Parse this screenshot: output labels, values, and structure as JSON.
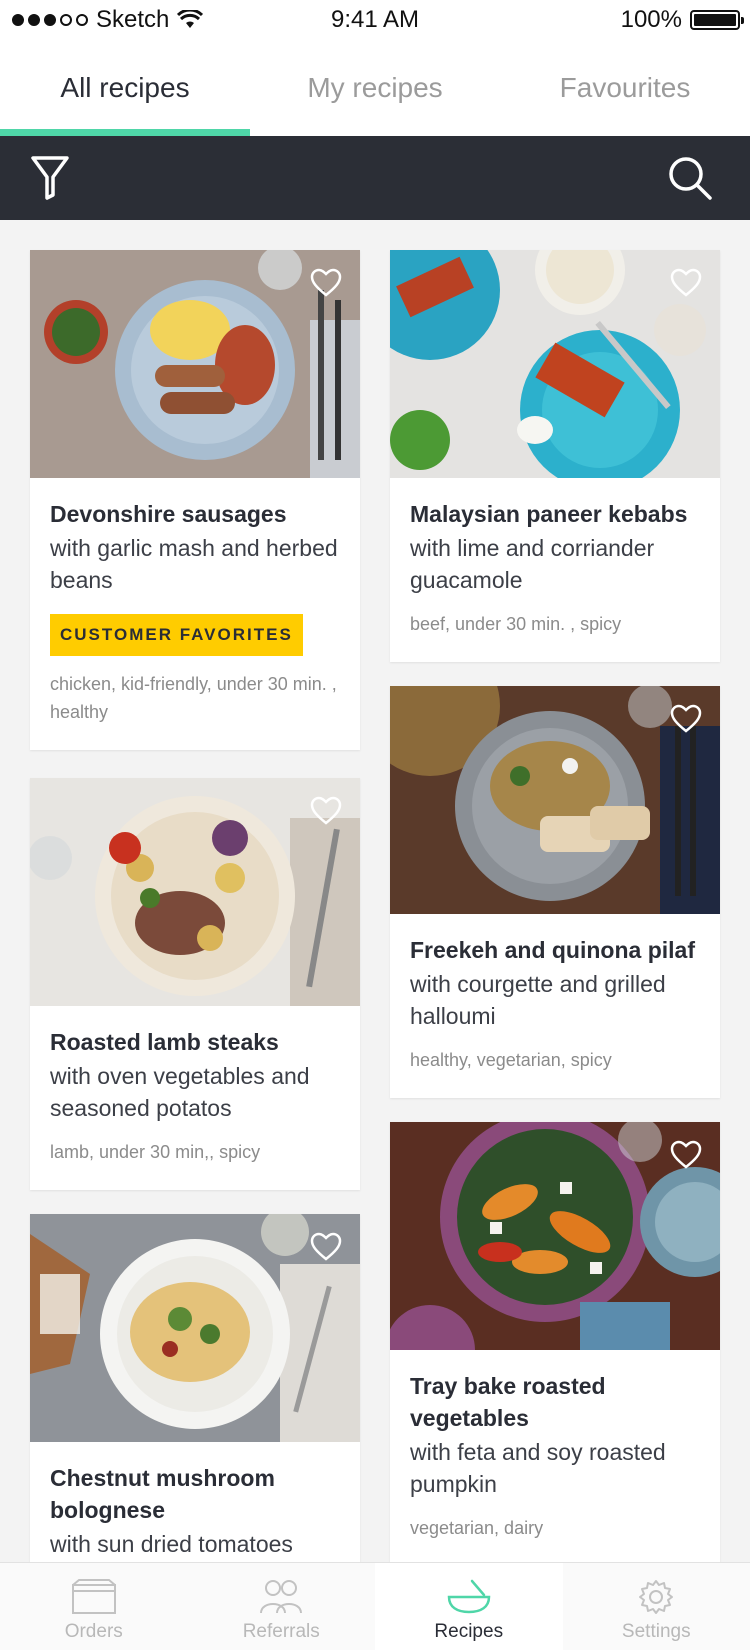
{
  "status_bar": {
    "carrier": "Sketch",
    "time": "9:41 AM",
    "battery": "100%"
  },
  "tabs": [
    {
      "label": "All recipes",
      "active": true
    },
    {
      "label": "My recipes",
      "active": false
    },
    {
      "label": "Favourites",
      "active": false
    }
  ],
  "toolbar": {
    "filter_icon": "filter-icon",
    "search_icon": "search-icon"
  },
  "recipes": [
    {
      "title": "Devonshire sausages",
      "subtitle": "with garlic mash and herbed beans",
      "badge": "CUSTOMER FAVORITES",
      "tags": "chicken, kid-friendly, under 30 min. , healthy"
    },
    {
      "title": "Malaysian paneer kebabs",
      "subtitle": "with lime and corriander guacamole",
      "tags": "beef, under 30 min. , spicy"
    },
    {
      "title": "Roasted lamb steaks",
      "subtitle": "with oven vegetables and seasoned potatos",
      "tags": "lamb, under 30 min,, spicy"
    },
    {
      "title": "Freekeh and quinona pilaf",
      "subtitle": "with courgette and grilled halloumi",
      "tags": "healthy, vegetarian, spicy"
    },
    {
      "title": "Chestnut mushroom bolognese",
      "subtitle": "with sun dried tomatoes",
      "tags": ""
    },
    {
      "title": "Tray bake roasted vegetables",
      "subtitle": "with feta and soy roasted pumpkin",
      "tags": "vegetarian, dairy"
    }
  ],
  "bottom_nav": [
    {
      "label": "Orders",
      "icon": "box-icon",
      "active": false
    },
    {
      "label": "Referrals",
      "icon": "people-icon",
      "active": false
    },
    {
      "label": "Recipes",
      "icon": "bowl-icon",
      "active": true
    },
    {
      "label": "Settings",
      "icon": "gear-icon",
      "active": false
    }
  ],
  "colors": {
    "accent": "#4fd6a8",
    "toolbar": "#2b2e36",
    "badge": "#ffcc00"
  }
}
